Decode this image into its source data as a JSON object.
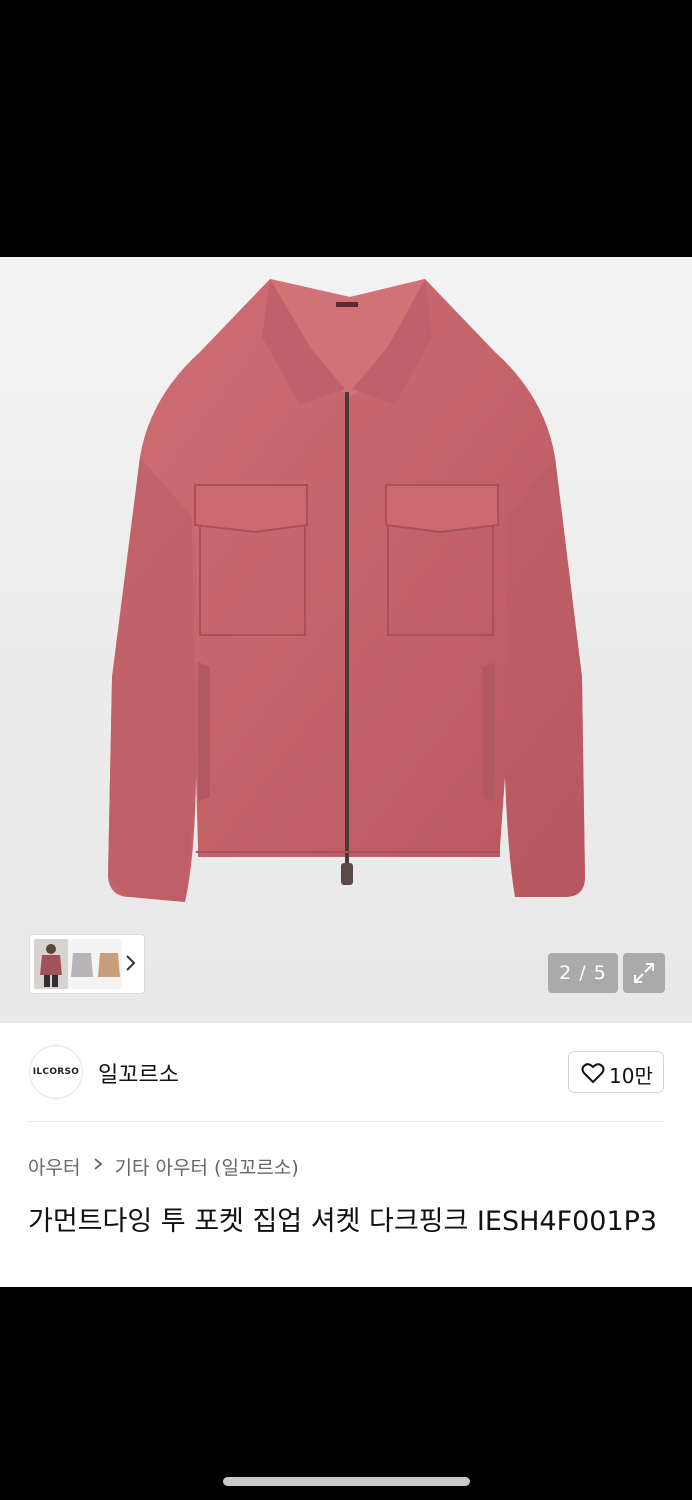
{
  "gallery": {
    "current_index": 2,
    "total_images": 5,
    "counter_text": "2 / 5",
    "expand_icon": "expand-icon",
    "thumbnail_arrow_icon": "chevron-right-icon",
    "thumbnail_count": 3
  },
  "brand": {
    "logo_text": "ILCORSO",
    "name": "일꼬르소"
  },
  "like": {
    "icon": "heart-icon",
    "count": "10만"
  },
  "breadcrumb": {
    "items": [
      "아우터",
      "기타 아우터 (일꼬르소)"
    ],
    "separator_icon": "chevron-right-icon"
  },
  "product": {
    "title": "가먼트다잉 투 포켓 집업 셔켓 다크핑크 IESH4F001P3"
  },
  "colors": {
    "jacket": "#c7646a",
    "background": "#ececec",
    "text": "#111111"
  }
}
